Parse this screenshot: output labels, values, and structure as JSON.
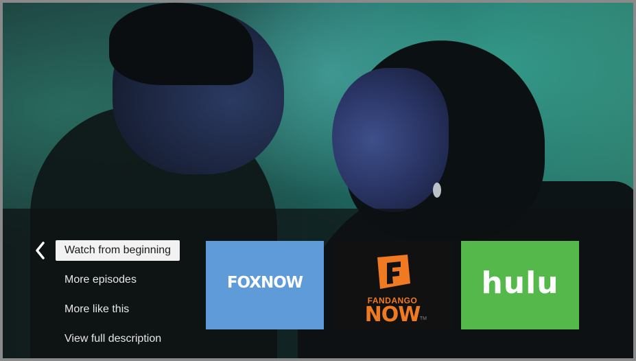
{
  "menu": {
    "items": [
      {
        "label": "Watch from beginning",
        "selected": true
      },
      {
        "label": "More episodes",
        "selected": false
      },
      {
        "label": "More like this",
        "selected": false
      },
      {
        "label": "View full description",
        "selected": false
      }
    ]
  },
  "providers": [
    {
      "name": "FOXNOW",
      "color": "#5e9bd8"
    },
    {
      "name": "FANDANGO NOW",
      "line1": "FANDANGO",
      "line2": "NOW",
      "tm": "TM",
      "color": "#111111",
      "accent": "#f07a22"
    },
    {
      "name": "hulu",
      "color": "#55b84a"
    }
  ],
  "icons": {
    "back": "chevron-left-icon",
    "fandango_mark": "fandango-f-icon"
  }
}
